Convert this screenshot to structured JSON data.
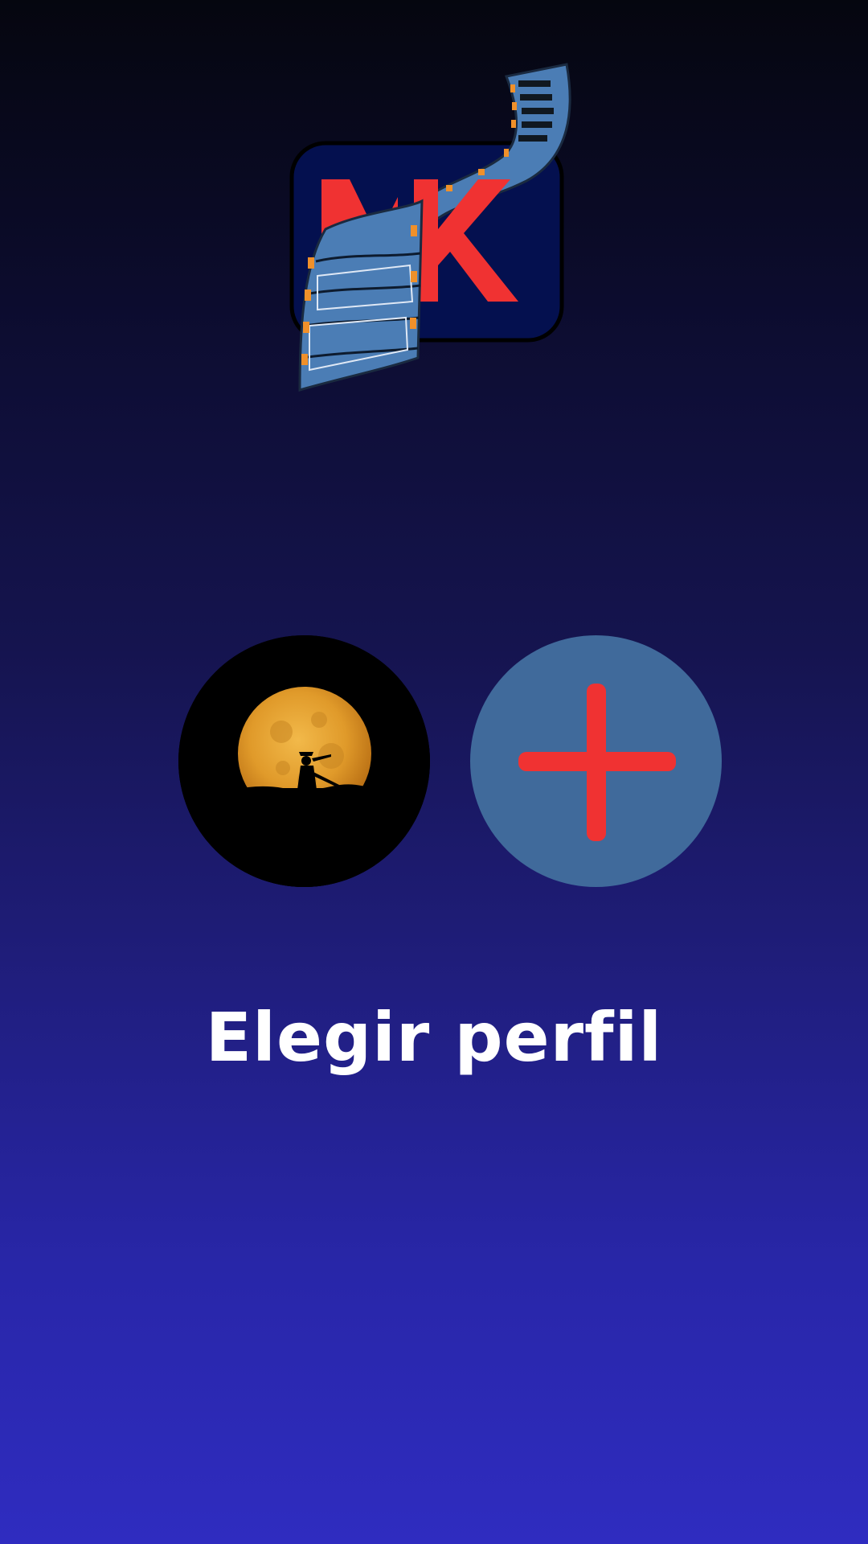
{
  "app": {
    "logo_text": "MK",
    "brand_color": "#f03232",
    "logo_bg": "#04104f",
    "film_color": "#4b7db5",
    "film_accent": "#f0902a"
  },
  "profiles": [
    {
      "type": "user-avatar",
      "image": "samurai-moon-avatar"
    },
    {
      "type": "add-profile",
      "icon": "plus-icon",
      "icon_color": "#f03232",
      "bg": "#406a9b"
    }
  ],
  "screen": {
    "title": "Elegir perfil"
  }
}
